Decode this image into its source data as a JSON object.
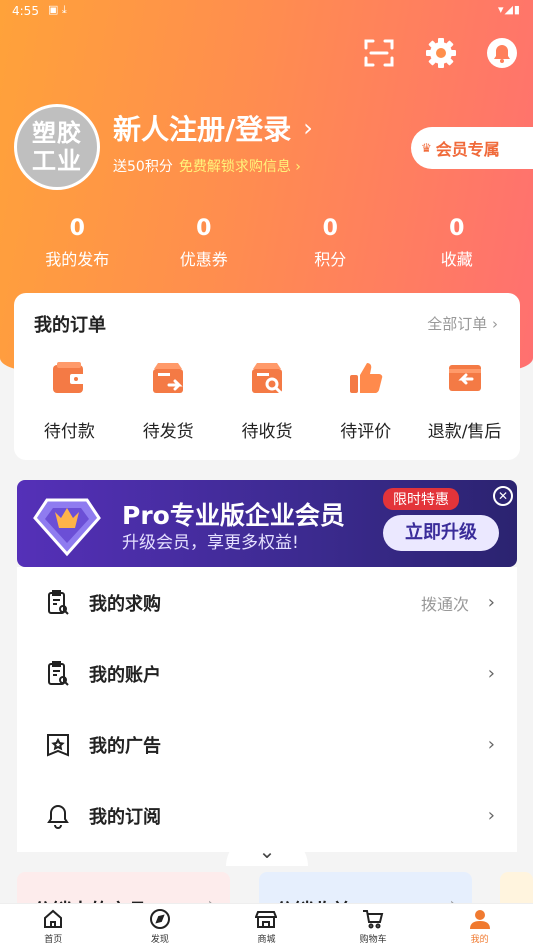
{
  "status_bar": {
    "time": "4:55",
    "left_icons": "▣ ⤓",
    "right_icons": "▾◢▮"
  },
  "header": {
    "avatar_line1": "塑胶",
    "avatar_line2": "工业",
    "login_title": "新人注册/登录",
    "login_chevron": "›",
    "reward_prefix": "送50积分",
    "reward_highlight": "免费解锁求购信息 ›",
    "vip_label": "会员专属",
    "vip_icon": "♛"
  },
  "stats": [
    {
      "value": "0",
      "label": "我的发布"
    },
    {
      "value": "0",
      "label": "优惠券"
    },
    {
      "value": "0",
      "label": "积分"
    },
    {
      "value": "0",
      "label": "收藏"
    }
  ],
  "orders": {
    "title": "我的订单",
    "all_link": "全部订单 ›",
    "items": [
      {
        "label": "待付款",
        "icon": "wallet-icon"
      },
      {
        "label": "待发货",
        "icon": "ship-box-icon"
      },
      {
        "label": "待收货",
        "icon": "receive-box-icon"
      },
      {
        "label": "待评价",
        "icon": "thumbs-up-icon"
      },
      {
        "label": "退款/售后",
        "icon": "refund-icon"
      }
    ]
  },
  "banner": {
    "title": "Pro专业版企业会员",
    "subtitle": "升级会员，享更多权益!",
    "limited": "限时特惠",
    "upgrade": "立即升级",
    "close": "✕"
  },
  "menu": [
    {
      "label": "我的求购",
      "extra": "拨通次",
      "icon": "clipboard-search-icon"
    },
    {
      "label": "我的账户",
      "extra": "",
      "icon": "clipboard-search-icon"
    },
    {
      "label": "我的广告",
      "extra": "",
      "icon": "ad-star-icon"
    },
    {
      "label": "我的订阅",
      "extra": "",
      "icon": "bell-icon"
    }
  ],
  "menu_chevron": "›",
  "collapse_icon": "⌄",
  "cards": [
    {
      "title": "分销中的产品",
      "chev": "›"
    },
    {
      "title": "分销收益",
      "chev": "›"
    }
  ],
  "tabbar": [
    {
      "label": "首页",
      "icon": "home-icon"
    },
    {
      "label": "发现",
      "icon": "compass-icon"
    },
    {
      "label": "商城",
      "icon": "store-icon"
    },
    {
      "label": "购物车",
      "icon": "cart-icon"
    },
    {
      "label": "我的",
      "icon": "user-icon",
      "active": true
    }
  ],
  "colors": {
    "accent": "#f07a30",
    "header_start": "#ffa23a",
    "header_end": "#ff7070",
    "banner": "#4a2fa8"
  }
}
